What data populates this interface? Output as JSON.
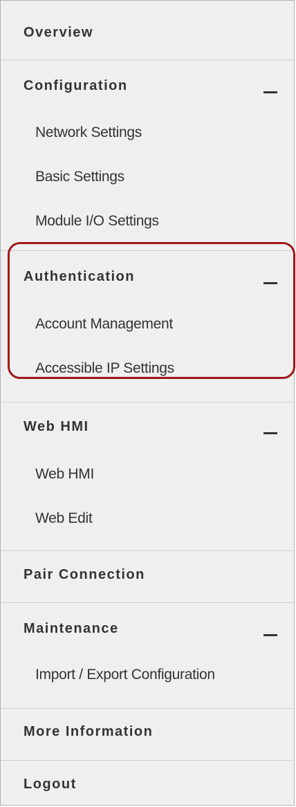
{
  "menu": {
    "overview": "Overview",
    "configuration": {
      "header": "Configuration",
      "items": [
        "Network Settings",
        "Basic Settings",
        "Module I/O Settings"
      ]
    },
    "authentication": {
      "header": "Authentication",
      "items": [
        "Account Management",
        "Accessible IP Settings"
      ]
    },
    "web_hmi": {
      "header": "Web HMI",
      "items": [
        "Web HMI",
        "Web Edit"
      ]
    },
    "pair_connection": "Pair Connection",
    "maintenance": {
      "header": "Maintenance",
      "items": [
        "Import / Export Configuration"
      ]
    },
    "more_information": "More Information",
    "logout": "Logout"
  },
  "icons": {
    "collapse": "minus-icon"
  },
  "colors": {
    "highlight": "#a01717",
    "background": "#efefef",
    "text": "#333333"
  }
}
